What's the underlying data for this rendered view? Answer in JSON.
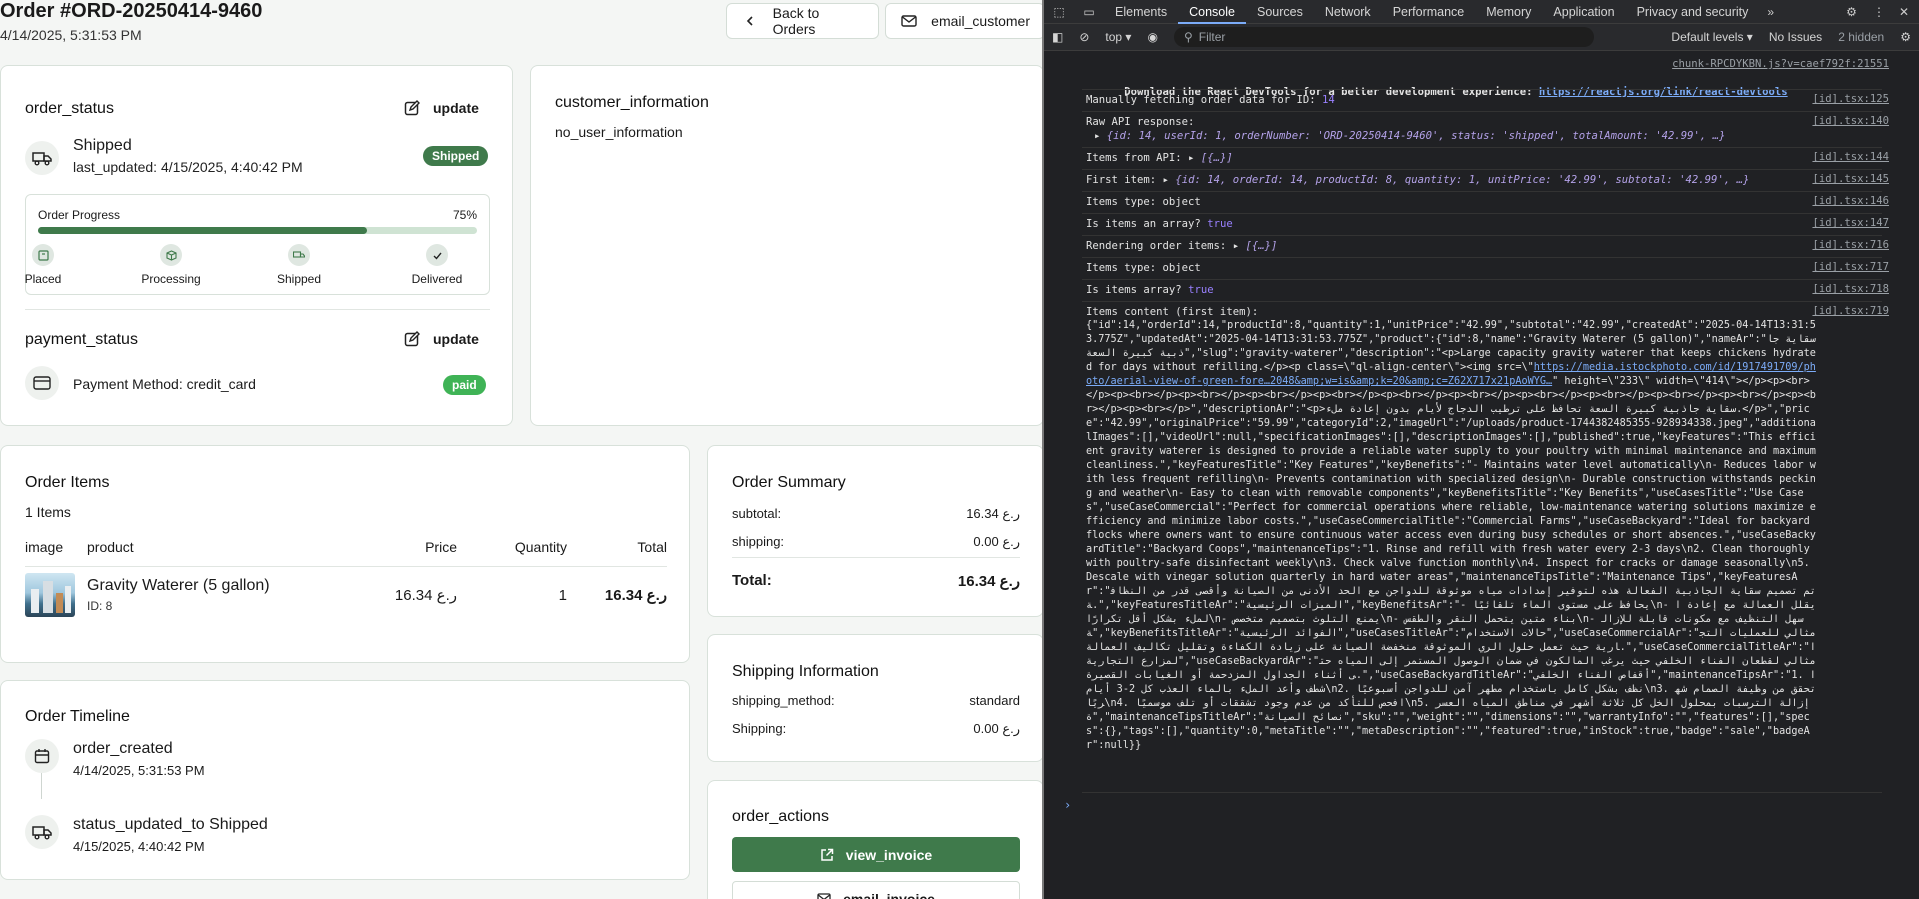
{
  "order": {
    "title": "Order #ORD-20250414-9460",
    "date": "4/14/2025, 5:31:53 PM",
    "back_label": "Back to Orders",
    "email_label": "email_customer"
  },
  "status_card": {
    "title": "order_status",
    "update_label": "update",
    "status": "Shipped",
    "last_updated": "last_updated: 4/15/2025, 4:40:42 PM",
    "badge": "Shipped",
    "progress_label": "Order Progress",
    "progress_percent_text": "75%",
    "progress_value": 0.75,
    "steps": [
      "Placed",
      "Processing",
      "Shipped",
      "Delivered"
    ]
  },
  "payment_card": {
    "title": "payment_status",
    "update_label": "update",
    "method": "Payment Method: credit_card",
    "badge": "paid"
  },
  "customer_card": {
    "title": "customer_information",
    "text": "no_user_information"
  },
  "items_card": {
    "title": "Order Items",
    "count": "1 Items",
    "headers": [
      "image",
      "product",
      "Price",
      "Quantity",
      "Total"
    ],
    "rows": [
      {
        "name": "Gravity Waterer (5 gallon)",
        "id": "ID: 8",
        "price": "16.34 ر.ع",
        "qty": "1",
        "total": "16.34 ر.ع"
      }
    ]
  },
  "summary_card": {
    "title": "Order Summary",
    "subtotal_label": "subtotal:",
    "subtotal": "16.34 ر.ع",
    "shipping_label": "shipping:",
    "shipping": "0.00 ر.ع",
    "total_label": "Total:",
    "total": "16.34 ر.ع"
  },
  "shipping_card": {
    "title": "Shipping Information",
    "method_label": "shipping_method:",
    "method": "standard",
    "shipping_label": "Shipping:",
    "shipping": "0.00 ر.ع"
  },
  "timeline_card": {
    "title": "Order Timeline",
    "events": [
      {
        "label": "order_created",
        "date": "4/14/2025, 5:31:53 PM"
      },
      {
        "label": "status_updated_to Shipped",
        "date": "4/15/2025, 4:40:42 PM"
      }
    ]
  },
  "actions_card": {
    "title": "order_actions",
    "view_invoice": "view_invoice",
    "email_invoice": "email_invoice"
  },
  "devtools": {
    "tabs": [
      "Elements",
      "Console",
      "Sources",
      "Network",
      "Performance",
      "Memory",
      "Application",
      "Privacy and security"
    ],
    "active_tab": "Console",
    "context": "top",
    "filter_placeholder": "Filter",
    "levels": "Default levels",
    "issues": "No Issues",
    "hidden": "2 hidden",
    "top_link": "chunk-RPCDYKBN.js?v=caef792f:21551",
    "logs": [
      {
        "text": "Manually fetching order data for ID:",
        "value": "14",
        "src": "[id].tsx:125"
      },
      {
        "text": "Raw API response:",
        "src": "[id].tsx:140"
      },
      {
        "text": "Items from API:",
        "src": "[id].tsx:144"
      },
      {
        "text": "First item:",
        "src": "[id].tsx:145"
      },
      {
        "text": "Items type: object",
        "src": "[id].tsx:146"
      },
      {
        "text": "Is items an array?",
        "value": "true",
        "src": "[id].tsx:147"
      },
      {
        "text": "Rendering order items:",
        "src": "[id].tsx:716"
      },
      {
        "text": "Items type: object",
        "src": "[id].tsx:717"
      },
      {
        "text": "Is items array?",
        "value": "true",
        "src": "[id].tsx:718"
      },
      {
        "text": "Items content (first item):",
        "src": "[id].tsx:719"
      }
    ],
    "react_devtools_text": "Download the React DevTools for a better development experience:",
    "react_devtools_link": "https://reactjs.org/link/react-devtools",
    "raw_api_obj": "{id: 14, userId: 1, orderNumber: 'ORD-20250414-9460', status: 'shipped', totalAmount: '42.99', …}",
    "items_obj": "[{…}]",
    "first_item_obj": "{id: 14, orderId: 14, productId: 8, quantity: 1, unitPrice: '42.99', subtotal: '42.99', …}",
    "render_items_obj": "[{…}]",
    "json_content_1": "{\"id\":14,\"orderId\":14,\"productId\":8,\"quantity\":1,\"unitPrice\":\"42.99\",\"subtotal\":\"42.99\",\"createdAt\":\"2025-04-14T13:31:53.775Z\",\"updatedAt\":\"2025-04-14T13:31:53.775Z\",\"product\":{\"id\":8,\"name\":\"Gravity Waterer (5 gallon)\",\"nameAr\":\"سقاية جاذبية كبيرة السعة\",\"slug\":\"gravity-waterer\",\"description\":\"<p>Large capacity gravity waterer that keeps chickens hydrated for days without refilling.</p><p class=\\\"ql-align-center\\\"><img src=\\\"",
    "json_link": "https://media.istockphoto.com/id/1917491709/photo/aerial-view-of-green-fore…2048&amp;w=is&amp;k=20&amp;c=Z62X717x21pAoWYG…",
    "json_content_2": "\" height=\\\"233\\\" width=\\\"414\\\"></p><p><br></p><p><br></p><p><br></p><p><br></p><p><br></p><p><br></p><p><br></p><p><br></p><p><br></p><p><br></p><p><br></p><p><br></p><p><br></p>\",\"descriptionAr\":\"<p>سقاية جاذبية كبيرة السعة تحافظ على ترطيب الدجاج لأيام بدون إعادة ملء.</p>\",\"price\":\"42.99\",\"originalPrice\":\"59.99\",\"categoryId\":2,\"imageUrl\":\"/uploads/product-1744382485355-928934338.jpeg\",\"additionalImages\":[],\"videoUrl\":null,\"specificationImages\":[],\"descriptionImages\":[],\"published\":true,\"keyFeatures\":\"This efficient gravity waterer is designed to provide a reliable water supply to your poultry with minimal maintenance and maximum cleanliness.\",\"keyFeaturesTitle\":\"Key Features\",\"keyBenefits\":\"- Maintains water level automatically\\n- Reduces labor with less frequent refilling\\n- Prevents contamination with specialized design\\n- Durable construction withstands pecking and weather\\n- Easy to clean with removable components\",\"keyBenefitsTitle\":\"Key Benefits\",\"useCasesTitle\":\"Use Cases\",\"useCaseCommercial\":\"Perfect for commercial operations where reliable, low-maintenance watering solutions maximize efficiency and minimize labor costs.\",\"useCaseCommercialTitle\":\"Commercial Farms\",\"useCaseBackyard\":\"Ideal for backyard flocks where owners want to ensure continuous water access even during busy schedules or short absences.\",\"useCaseBackyardTitle\":\"Backyard Coops\",\"maintenanceTips\":\"1. Rinse and refill with fresh water every 2-3 days\\n2. Clean thoroughly with poultry-safe disinfectant weekly\\n3. Check valve function monthly\\n4. Inspect for cracks or damage seasonally\\n5. Descale with vinegar solution quarterly in hard water areas\",\"maintenanceTipsTitle\":\"Maintenance Tips\",\"keyFeaturesAr\":\"تم تصميم سقاية الجاذبية الفعالة هذه لتوفير إمدادات مياه موثوقة للدواجن مع الحد الأدنى من الصيانة وأقصى قدر من النظافة.\",\"keyFeaturesTitleAr\":\"الميزات الرئيسية\",\"keyBenefitsAr\":\"- يحافظ على مستوى الماء تلقائيًا\\n- يقلل العمالة مع إعادة الملء بشكل أقل تكرارًا\\n- يمنع التلوث بتصميم متخصص\\n- بناء متين يتحمل النقر والطقس\\n- سهل التنظيف مع مكونات قابلة للإزالة\",\"keyBenefitsTitleAr\":\"الفوائد الرئيسية\",\"useCasesTitleAr\":\"حالات الاستخدام\",\"useCaseCommercialAr\":\"مثالي للعمليات التجارية حيث تعمل حلول الري الموثوقة منخفضة الصيانة على زيادة الكفاءة وتقليل تكاليف العمالة.\",\"useCaseCommercialTitleAr\":\"المزارع التجارية\",\"useCaseBackyardAr\":\"مثالي لقطعان الفناء الخلفي حيث يرغب المالكون في ضمان الوصول المستمر إلى المياه حتى أثناء الجداول المزدحمة أو الغيابات القصيرة.\",\"useCaseBackyardTitleAr\":\"أقفاص الفناء الخلفي\",\"maintenanceTipsAr\":\"1. اشطف وأعد الملء بالماء العذب كل 2-3 أيام\\n2. نظف بشكل كامل باستخدام مطهر آمن للدواجن أسبوعيًا\\n3. تحقق من وظيفة الصمام شهريًا\\n4. افحص للتأكد من عدم وجود تشققات أو تلف موسميًا\\n5. إزالة الترسبات بمحلول الخل كل ثلاثة أشهر في مناطق المياه العسرة\",\"maintenanceTipsTitleAr\":\"نصائح الصيانة\",\"sku\":\"\",\"weight\":\"\",\"dimensions\":\"\",\"warrantyInfo\":\"\",\"features\":[],\"specs\":{},\"tags\":[],\"quantity\":0,\"metaTitle\":\"\",\"metaDescription\":\"\",\"featured\":true,\"inStock\":true,\"badge\":\"sale\",\"badgeAr\":null}}"
  },
  "colors": {
    "brand_green": "#3f7a4b",
    "progress_track": "#cfe3d3",
    "devtools_bg": "#202124"
  }
}
